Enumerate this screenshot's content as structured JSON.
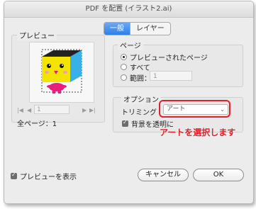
{
  "window": {
    "title": "PDF を配置 (イラスト2.ai)"
  },
  "preview_panel": {
    "legend": "プレビュー",
    "nav": {
      "first": "|◀",
      "prev": "◀",
      "page": "1",
      "next": "▶",
      "last": "▶|"
    },
    "total_pages_label": "全ページ：1"
  },
  "tabs": [
    {
      "label": "一般",
      "active": true
    },
    {
      "label": "レイヤー",
      "active": false
    }
  ],
  "pages_section": {
    "legend": "ページ",
    "options": [
      {
        "label": "プレビューされたページ",
        "selected": true
      },
      {
        "label": "すべて",
        "selected": false
      },
      {
        "label": "範囲：",
        "selected": false
      }
    ],
    "range_value": "1"
  },
  "options_section": {
    "legend": "オプション",
    "crop_label": "トリミング",
    "crop_value": "アート",
    "transparent_bg_label": "背景を透明に",
    "transparent_bg_checked": true
  },
  "annotation": {
    "text": "アートを選択します",
    "color": "#e0202a"
  },
  "footer": {
    "show_preview_label": "プレビューを表示",
    "show_preview_checked": true,
    "cancel_label": "キャンセル",
    "ok_label": "OK"
  },
  "colors": {
    "accent": "#2f7fe8",
    "highlight": "#e0202a",
    "cube_top": "#222222",
    "cube_front": "#f3e500",
    "cube_side": "#3ab0e8",
    "body": "#e4207c"
  }
}
